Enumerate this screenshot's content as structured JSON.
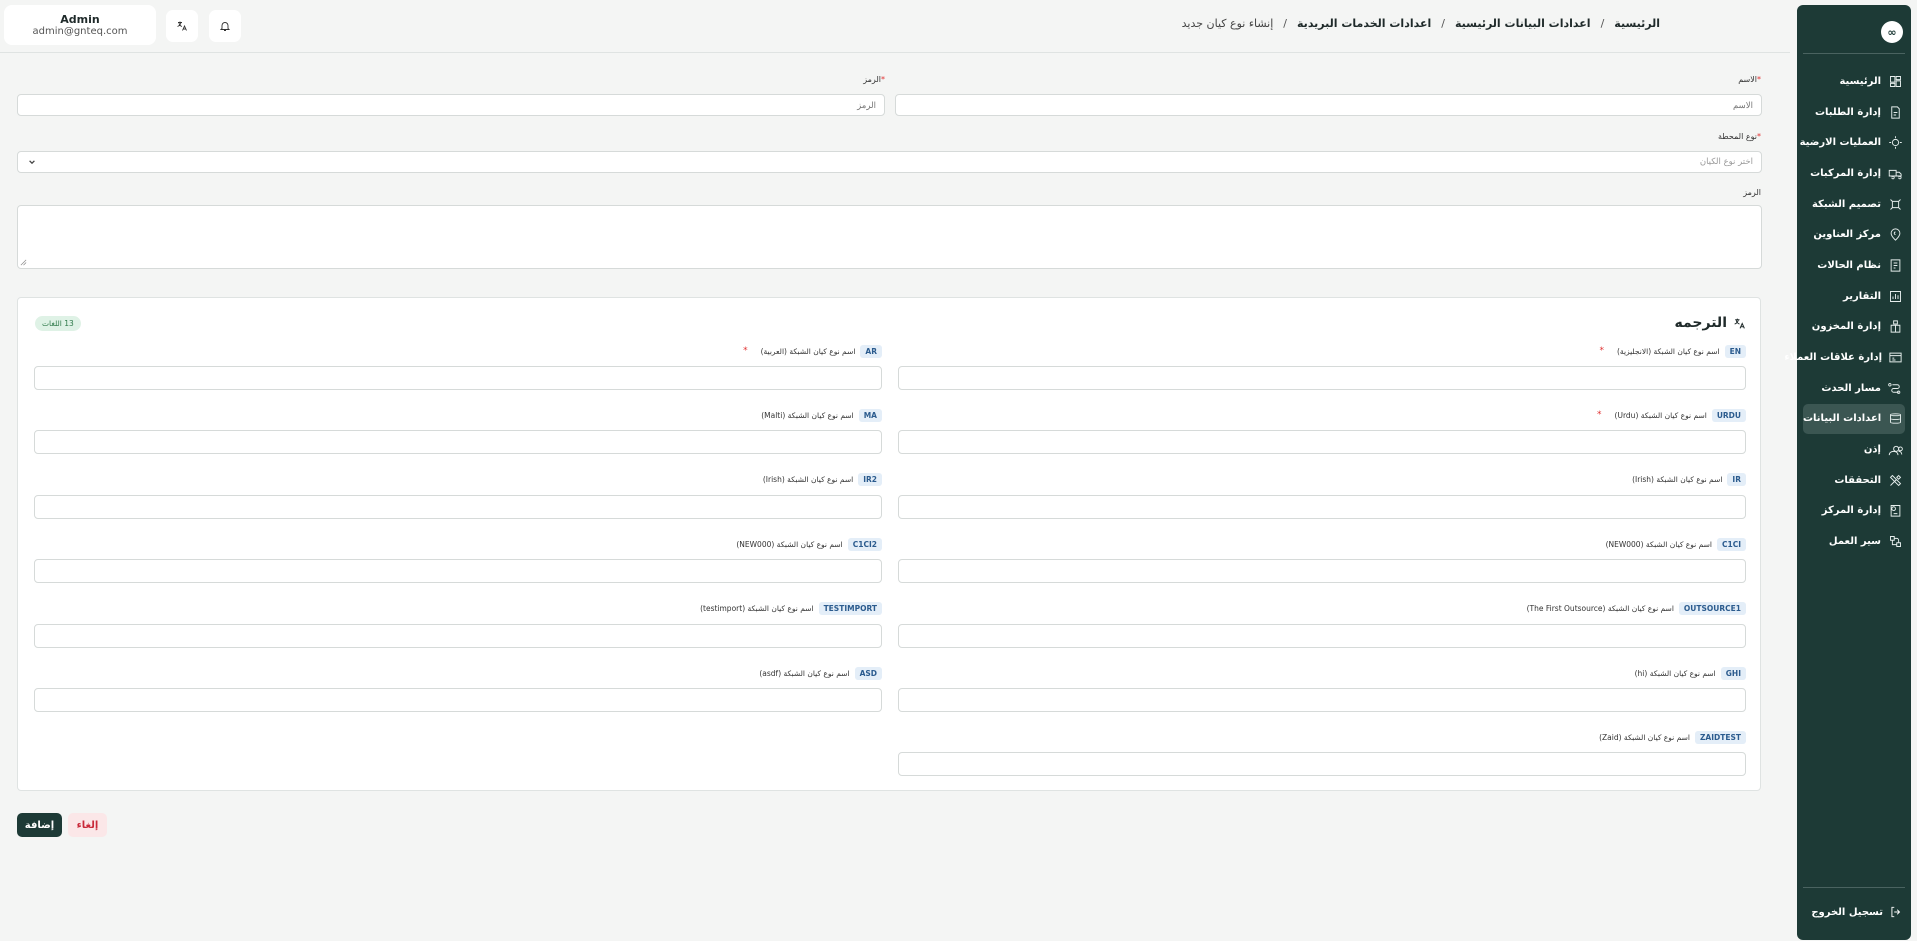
{
  "header": {
    "user": {
      "name": "Admin",
      "email": "admin@gnteq.com"
    },
    "breadcrumb": [
      "الرئيسية",
      "اعدادات البيانات الرئيسية",
      "اعدادات الخدمات البريدية",
      "إنشاء نوع كيان جديد"
    ],
    "separator": "/"
  },
  "sidebar": {
    "logo": "∞",
    "items": [
      {
        "label": "الرئيسية",
        "icon": "dashboard-icon"
      },
      {
        "label": "إدارة الطلبات",
        "icon": "orders-icon"
      },
      {
        "label": "العمليات الارضية",
        "icon": "ground-ops-icon"
      },
      {
        "label": "إدارة المركبات",
        "icon": "truck-icon"
      },
      {
        "label": "تصميم الشبكة",
        "icon": "network-icon"
      },
      {
        "label": "مركز العناوين",
        "icon": "address-pin-icon"
      },
      {
        "label": "نظام الحالات",
        "icon": "status-icon"
      },
      {
        "label": "التقارير",
        "icon": "reports-icon"
      },
      {
        "label": "إدارة المخزون",
        "icon": "inventory-icon"
      },
      {
        "label": "إدارة علاقات العملاء",
        "icon": "crm-icon"
      },
      {
        "label": "مسار الحدث",
        "icon": "route-icon"
      },
      {
        "label": "اعدادات البيانات",
        "icon": "database-icon"
      },
      {
        "label": "إذن",
        "icon": "users-icon"
      },
      {
        "label": "التحققات",
        "icon": "tools-icon"
      },
      {
        "label": "إدارة المركز",
        "icon": "center-icon"
      },
      {
        "label": "سير العمل",
        "icon": "workflow-icon"
      }
    ],
    "active_index": 11,
    "logout": "تسجيل الخروج"
  },
  "form": {
    "name": {
      "label": "الاسم",
      "placeholder": "الاسم",
      "required": "*"
    },
    "code": {
      "label": "الرمز",
      "placeholder": "الرمز",
      "required": "*"
    },
    "station_type": {
      "label": "نوع المحطة",
      "placeholder": "اختر نوع الكيان",
      "required": "*"
    },
    "description": {
      "label": "الرمز"
    }
  },
  "translation": {
    "title": "الترجمه",
    "badge": "13 اللغات",
    "fields": [
      {
        "code": "EN",
        "label": "اسم نوع كيان الشبكة (الانجليزية)",
        "required": "*"
      },
      {
        "code": "AR",
        "label": "اسم نوع كيان الشبكة (العربية)",
        "required": "*"
      },
      {
        "code": "URDU",
        "label": "اسم نوع كيان الشبكة (Urdu)",
        "required": "*"
      },
      {
        "code": "MA",
        "label": "اسم نوع كيان الشبكة (Malti)",
        "required": ""
      },
      {
        "code": "IR",
        "label": "اسم نوع كيان الشبكة (Irish)",
        "required": ""
      },
      {
        "code": "IR2",
        "label": "اسم نوع كيان الشبكة (Irish)",
        "required": ""
      },
      {
        "code": "C1CI",
        "label": "اسم نوع كيان الشبكة (NEW000)",
        "required": ""
      },
      {
        "code": "C1CI2",
        "label": "اسم نوع كيان الشبكة (NEW000)",
        "required": ""
      },
      {
        "code": "OUTSOURCE1",
        "label": "اسم نوع كيان الشبكة (The First Outsource)",
        "required": ""
      },
      {
        "code": "TESTIMPORT",
        "label": "اسم نوع كيان الشبكة (testimport)",
        "required": ""
      },
      {
        "code": "GHI",
        "label": "اسم نوع كيان الشبكة (hi)",
        "required": ""
      },
      {
        "code": "ASD",
        "label": "اسم نوع كيان الشبكة (asdf)",
        "required": ""
      },
      {
        "code": "ZAIDTEST",
        "label": "اسم نوع كيان الشبكة (Zaid)",
        "required": ""
      }
    ]
  },
  "actions": {
    "add": "إضافة",
    "cancel": "إلغاء"
  }
}
